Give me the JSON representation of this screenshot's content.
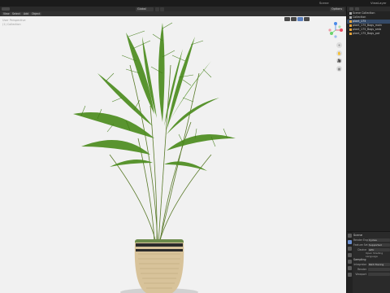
{
  "topbar": {
    "license_text": "",
    "scene": "Scene",
    "view_layer": "ViewLayer"
  },
  "viewport": {
    "pivot_label": "Global",
    "options_label": "Options",
    "menus": [
      "View",
      "Select",
      "Add",
      "Object"
    ],
    "overlay_lines": [
      "User Perspective",
      "(1) Collection"
    ],
    "nav_icons": [
      "+",
      "✋",
      "🎥",
      "▦"
    ],
    "gizmo_colors": {
      "x": "#e84a5f",
      "y": "#6bd46b",
      "z": "#4a8ae8"
    }
  },
  "outliner": {
    "rows": [
      {
        "label": "Scene Collection",
        "type": "collection"
      },
      {
        "label": "Collection",
        "type": "collection"
      },
      {
        "label": "plant_175",
        "type": "object",
        "selected": true
      },
      {
        "label": "plant_175_Bags_main",
        "type": "object"
      },
      {
        "label": "plant_175_Bags_amb",
        "type": "object"
      },
      {
        "label": "plant_175_Bags_pot",
        "type": "object"
      }
    ]
  },
  "properties": {
    "title": "Scene",
    "render_engine_label": "Render Engine",
    "render_engine_value": "Cycles",
    "feature_set_label": "Feature Set",
    "feature_set_value": "Supported",
    "device_label": "Device",
    "device_value": "GPU",
    "open_shading_label": "Open Shading Language",
    "sampling_label": "Sampling",
    "integrator_label": "Integrator",
    "integrator_value": "Path Tracing",
    "render_label": "Render",
    "viewport_label": "Viewport"
  }
}
